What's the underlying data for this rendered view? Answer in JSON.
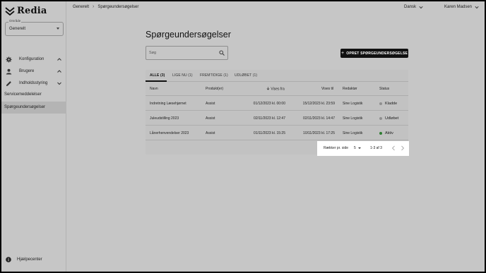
{
  "brand": {
    "name": "Redia"
  },
  "sidebar": {
    "select": {
      "label": "Område",
      "value": "Generelt"
    },
    "items": [
      {
        "label": "Konfiguration",
        "icon": "gear-icon"
      },
      {
        "label": "Brugere",
        "icon": "person-icon"
      },
      {
        "label": "Indholdsstyring",
        "icon": "pencil-icon"
      }
    ],
    "sub_items": [
      {
        "label": "Servicemeddelelser"
      },
      {
        "label": "Spørgeundersøgelser"
      }
    ],
    "help": {
      "label": "Hjælpecenter",
      "icon": "info-icon"
    }
  },
  "topbar": {
    "breadcrumbs": [
      "Generelt",
      "Spørgeundersøgelser"
    ],
    "language": "Dansk",
    "user": "Karen Madsen"
  },
  "main": {
    "title": "Spørgeundersøgelser",
    "search_placeholder": "Søg",
    "create_button": "OPRET SPØRGEUNDERSØGELSE",
    "tabs": [
      "ALLE (3)",
      "LIGE NU (1)",
      "FREMTIDIGE (1)",
      "UDLØBET (1)"
    ],
    "columns": {
      "name": "Navn",
      "product": "Produkt(er)",
      "shown_from": "Vises fra",
      "shown_to": "Vises til",
      "editor": "Redaktør",
      "status": "Status"
    },
    "rows": [
      {
        "name": "Indretning Læsehjørnet",
        "product": "Assist",
        "from": "01/12/2023 kl. 00:00",
        "to": "15/12/2023 kl. 23:59",
        "editor": "Sine Logistik",
        "status": "Kladde",
        "status_color": "#8f8f8f"
      },
      {
        "name": "Juleudstilling 2023",
        "product": "Assist",
        "from": "02/11/2023 kl. 12:47",
        "to": "02/11/2023 kl. 14:47",
        "editor": "Sine Logistik",
        "status": "Udløbet",
        "status_color": "#8f8f8f"
      },
      {
        "name": "Lånerhenvendelser 2023",
        "product": "Assist",
        "from": "01/11/2023 kl. 15:25",
        "to": "10/11/2023 kl. 17:25",
        "editor": "Sine Logistik",
        "status": "Aktiv",
        "status_color": "#2e7d32"
      }
    ],
    "pagination": {
      "rows_per_page_label": "Rækker pr. side",
      "rows_per_page": "5",
      "range": "1-3 af 3"
    }
  }
}
